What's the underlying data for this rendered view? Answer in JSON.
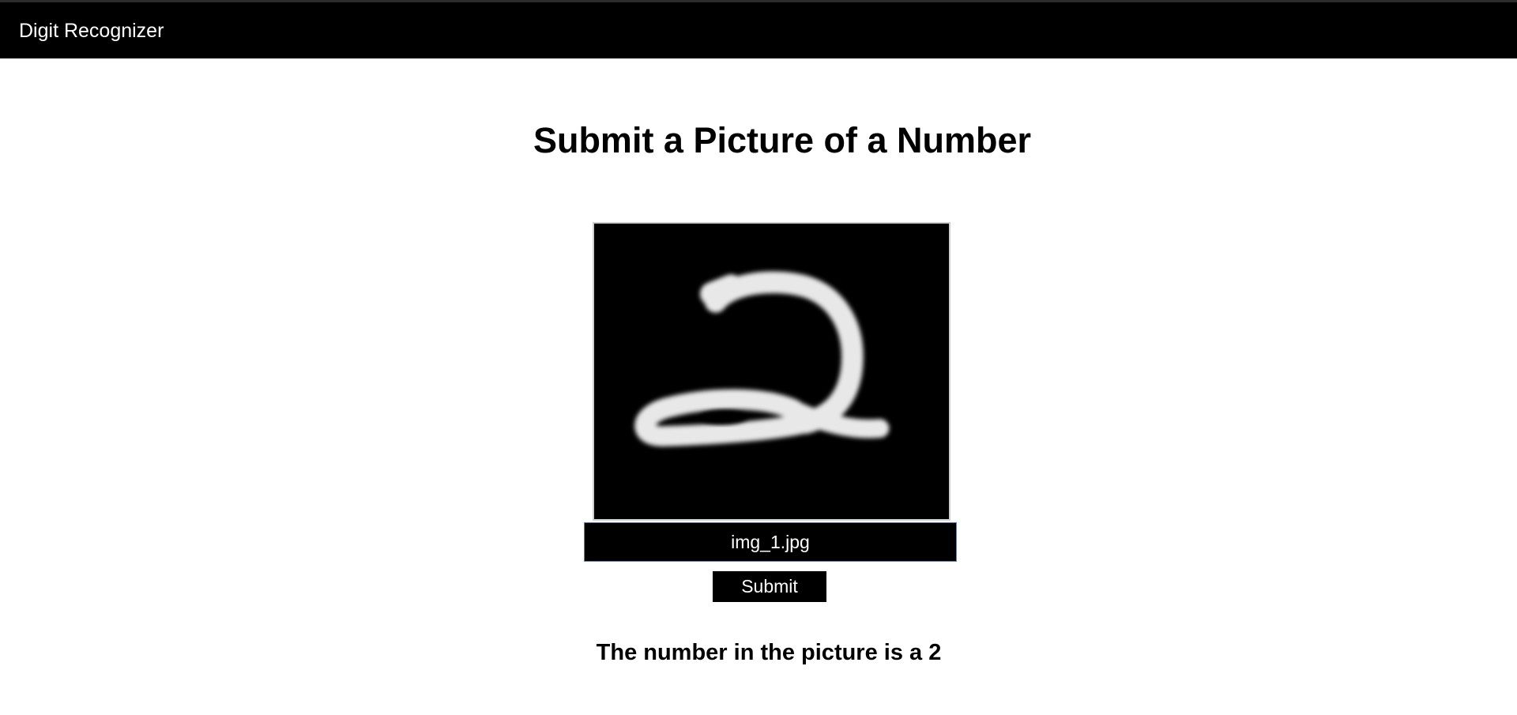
{
  "navbar": {
    "brand": "Digit Recognizer"
  },
  "main": {
    "title": "Submit a Picture of a Number",
    "preview_image": "handwritten digit image",
    "file_input": {
      "value": "img_1.jpg"
    },
    "submit_label": "Submit",
    "result_text": "The number in the picture is a 2"
  },
  "colors": {
    "navbar_bg": "#000000",
    "text": "#000000",
    "button_bg": "#000000",
    "button_text": "#ffffff"
  }
}
